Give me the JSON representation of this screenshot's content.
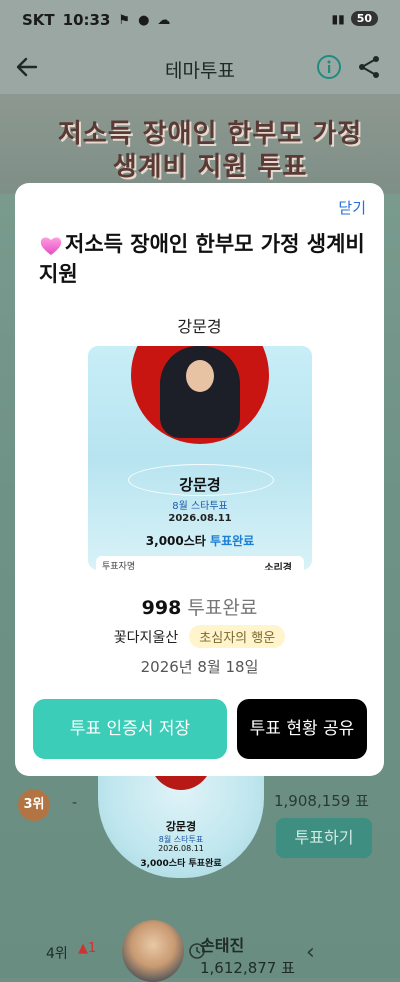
{
  "status_bar": {
    "carrier": "SKT",
    "time": "10:33",
    "battery": "50"
  },
  "app_bar": {
    "title": "테마투표"
  },
  "banner": {
    "line1": "저소득 장애인 한부모 가정",
    "line2": "생계비 지원 투표"
  },
  "modal": {
    "close_label": "닫기",
    "title": "저소득 장애인 한부모 가정 생계비 지원",
    "candidate_name": "강문경",
    "certificate": {
      "name": "강문경",
      "subtitle": "8월 스타투표",
      "date": "2026.08.11",
      "star_amount": "3,000스타",
      "star_status": "투표완료",
      "footer_left": "투표자명",
      "footer_right": "소리경"
    },
    "vote_count": "998",
    "vote_count_label": "투표완료",
    "nickname": "꽃다지울산",
    "level_badge": "초심자의 행운",
    "vote_date": "2026년 8월 18일",
    "save_button": "투표 인증서 저장",
    "share_button": "투표 현황 공유"
  },
  "background_list": {
    "rank3_label": "3위",
    "rank3_change": "-",
    "rank3_votes": "1,908,159 표",
    "vote_button": "투표하기",
    "rank3_card": {
      "name": "강문경",
      "subtitle": "8월 스타투표",
      "date": "2026.08.11",
      "star": "3,000스타 투표완료"
    },
    "rank4_label": "4위",
    "rank4_change": "1",
    "rank4_name": "손태진",
    "rank4_votes": "1,612,877 표"
  },
  "colors": {
    "accent": "#3ccdb9",
    "link": "#2a6fd6",
    "badge_bg": "#fff4cc"
  }
}
